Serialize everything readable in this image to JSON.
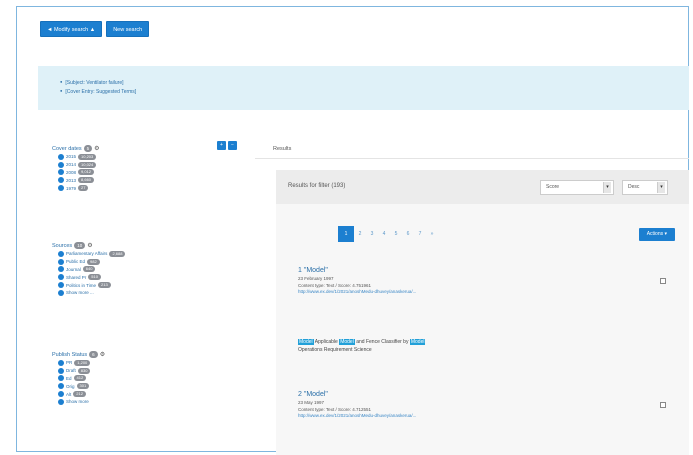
{
  "top_buttons": {
    "modify_search": "◄ Modify search ▲",
    "new_search": "New search"
  },
  "breadcrumbs": [
    "[Subject: Ventilator failure]",
    "[Cover Entry: Suggested Terms]"
  ],
  "facets": [
    {
      "title": "Cover dates",
      "count": "5",
      "items": [
        {
          "label": "2015",
          "count": "10,203"
        },
        {
          "label": "2014",
          "count": "10,024"
        },
        {
          "label": "2008",
          "count": "9,012"
        },
        {
          "label": "2013",
          "count": "8,660"
        },
        {
          "label": "1979",
          "count": "27"
        }
      ]
    },
    {
      "title": "Sources",
      "count": "10",
      "items": [
        {
          "label": "Parliamentary Affairs",
          "count": "2,688"
        },
        {
          "label": "Public Ed",
          "count": "982"
        },
        {
          "label": "Journal",
          "count": "640"
        },
        {
          "label": "Shared Pr",
          "count": "510"
        },
        {
          "label": "Politics in Time",
          "count": "213"
        },
        {
          "label": "Show more ...",
          "count": ""
        }
      ]
    },
    {
      "title": "Publish Status",
      "count": "6",
      "items": [
        {
          "label": "PR",
          "count": "1,200"
        },
        {
          "label": "Draft",
          "count": "830"
        },
        {
          "label": "Ed",
          "count": "412"
        },
        {
          "label": "Orig",
          "count": "301"
        },
        {
          "label": "Alt",
          "count": "212"
        },
        {
          "label": "Show more",
          "count": ""
        }
      ]
    }
  ],
  "toggles": [
    "+",
    "−"
  ],
  "results_tab": "Results",
  "panel": {
    "title": "Results for filter (193)",
    "sort_label": "Score",
    "order_label": "Desc",
    "pages": [
      "1",
      "2",
      "3",
      "4",
      "5",
      "6",
      "7",
      "»"
    ],
    "actions_label": "Actions ▾"
  },
  "results": [
    {
      "title": "1 \"Model\"",
      "date": "23 February 1997",
      "content_type": "Content type: Text / Score: 4.751961",
      "url": "http://www.ex.dev/1/2021/anoshMedu-dhuvey/anaskerua/..."
    },
    {
      "title": "2 \"Model\"",
      "date": "23 May 1997",
      "content_type": "Content type: Text / Score: 4.712551",
      "url": "http://www.ex.dev/1/2021/anoshMedu-dhuvey/anaskerua/..."
    }
  ],
  "snippet": {
    "hl1": "Model",
    "t1": " Applicable ",
    "hl2": "Model",
    "t2": " and Fence Classifier by ",
    "hl3": "Model",
    "line2": "Operations Requirement Science"
  },
  "colors": {
    "accent": "#1c7fd0",
    "breadcrumb_bg": "#dff1f8",
    "badge": "#8b8f96",
    "highlight": "#22a0d8"
  }
}
